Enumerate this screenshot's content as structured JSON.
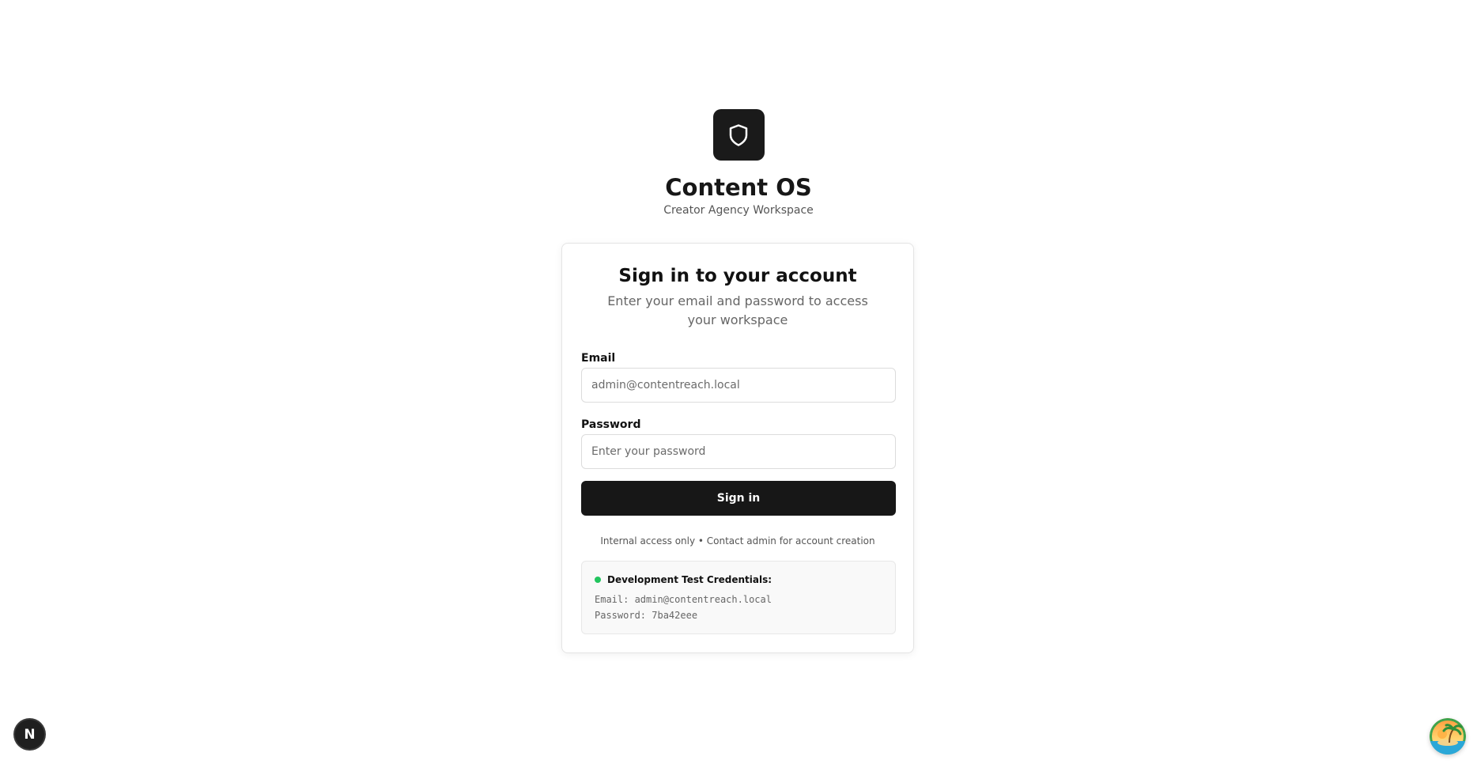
{
  "brand": {
    "logo_icon": "shield-icon",
    "title": "Content OS",
    "subtitle": "Creator Agency Workspace"
  },
  "login": {
    "title": "Sign in to your account",
    "description": "Enter your email and password to access your workspace",
    "email_label": "Email",
    "email_placeholder": "admin@contentreach.local",
    "email_value": "",
    "password_label": "Password",
    "password_placeholder": "Enter your password",
    "password_value": "",
    "submit_label": "Sign in",
    "note": "Internal access only • Contact admin for account creation"
  },
  "dev_credentials": {
    "status_color": "#22c55e",
    "title": "Development Test Credentials:",
    "email_line": "Email: admin@contentreach.local",
    "password_line": "Password: 7ba42eee"
  },
  "overlay": {
    "dev_badge_letter": "N",
    "dev_badge_icon": "nextjs-icon",
    "assistant_icon": "tropical-island-icon"
  },
  "colors": {
    "primary": "#171717",
    "background": "#ffffff",
    "status_dot": "#22c55e"
  }
}
